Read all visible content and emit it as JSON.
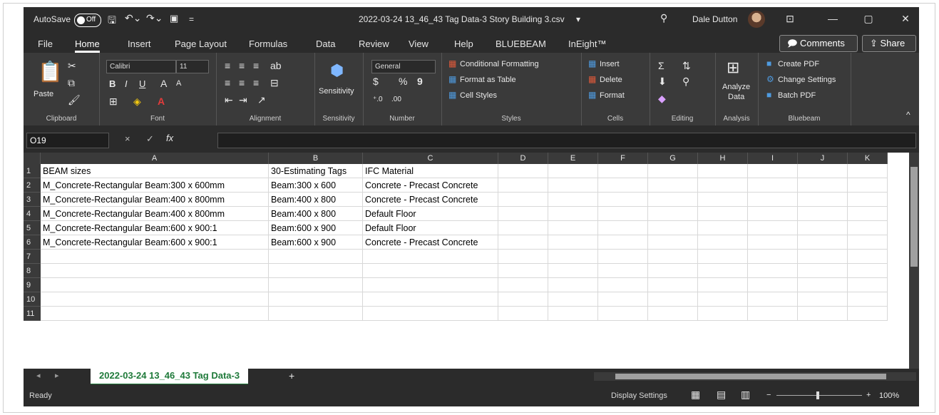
{
  "titlebar": {
    "autosave_label": "AutoSave",
    "autosave_state": "Off",
    "doc_title": "2022-03-24 13_46_43 Tag Data-3 Story Building 3.csv",
    "title_dropdown": "▾",
    "user_name": "Dale Dutton",
    "icons": [
      "save-icon",
      "undo-icon",
      "redo-icon",
      "customize-icon",
      "search-icon",
      "ribbon-display-icon",
      "minimize-icon",
      "restore-icon",
      "close-icon"
    ]
  },
  "ribbon_tabs": [
    "File",
    "Home",
    "Insert",
    "Page Layout",
    "Formulas",
    "Data",
    "Review",
    "View",
    "Help",
    "BLUEBEAM",
    "InEight™"
  ],
  "ribbon_active_tab": "Home",
  "ribbon_actions": {
    "comments": "Comments",
    "share": "Share"
  },
  "ribbon": {
    "clipboard": {
      "paste": "Paste",
      "label": "Clipboard"
    },
    "font": {
      "name": "Calibri",
      "size": "11",
      "label": "Font"
    },
    "alignment": {
      "label": "Alignment"
    },
    "sensitivity": {
      "button": "Sensitivity",
      "label": "Sensitivity"
    },
    "number": {
      "format": "General",
      "currency": "$",
      "percent": "%",
      "comma": "9",
      "label": "Number"
    },
    "styles": {
      "conditional": "Conditional Formatting",
      "table": "Format as Table",
      "cell": "Cell Styles",
      "label": "Styles"
    },
    "cells": {
      "insert": "Insert",
      "delete": "Delete",
      "format": "Format",
      "label": "Cells"
    },
    "editing": {
      "label": "Editing"
    },
    "analysis": {
      "button_line1": "Analyze",
      "button_line2": "Data",
      "label": "Analysis"
    },
    "bluebeam": {
      "create": "Create PDF",
      "settings": "Change Settings",
      "batch": "Batch PDF",
      "label": "Bluebeam"
    }
  },
  "formula_bar": {
    "name_box": "O19",
    "fx": "fx",
    "cancel": "×",
    "enter": "✓",
    "value": ""
  },
  "columns": [
    "A",
    "B",
    "C",
    "D",
    "E",
    "F",
    "G",
    "H",
    "I",
    "J",
    "K"
  ],
  "rows": [
    {
      "num": "1",
      "cells": [
        "BEAM sizes",
        "30-Estimating Tags",
        "IFC Material"
      ]
    },
    {
      "num": "2",
      "cells": [
        "M_Concrete-Rectangular Beam:300 x 600mm",
        "Beam:300 x 600",
        "Concrete - Precast Concrete"
      ]
    },
    {
      "num": "3",
      "cells": [
        "M_Concrete-Rectangular Beam:400 x 800mm",
        "Beam:400 x 800",
        "Concrete - Precast Concrete"
      ]
    },
    {
      "num": "4",
      "cells": [
        "M_Concrete-Rectangular Beam:400 x 800mm",
        "Beam:400 x 800",
        "Default Floor"
      ]
    },
    {
      "num": "5",
      "cells": [
        "M_Concrete-Rectangular Beam:600 x 900:1",
        "Beam:600 x 900",
        "Default Floor"
      ]
    },
    {
      "num": "6",
      "cells": [
        "M_Concrete-Rectangular Beam:600 x 900:1",
        "Beam:600 x 900",
        "Concrete - Precast Concrete"
      ]
    },
    {
      "num": "7",
      "cells": [
        "",
        "",
        ""
      ]
    },
    {
      "num": "8",
      "cells": [
        "",
        "",
        ""
      ]
    },
    {
      "num": "9",
      "cells": [
        "",
        "",
        ""
      ]
    },
    {
      "num": "10",
      "cells": [
        "",
        "",
        ""
      ]
    },
    {
      "num": "11",
      "cells": [
        "",
        "",
        ""
      ]
    }
  ],
  "sheet_tab": "2022-03-24 13_46_43 Tag Data-3",
  "add_sheet": "+",
  "status": {
    "ready": "Ready",
    "display_settings": "Display Settings",
    "zoom": "100%",
    "zoom_minus": "−",
    "zoom_plus": "+"
  }
}
